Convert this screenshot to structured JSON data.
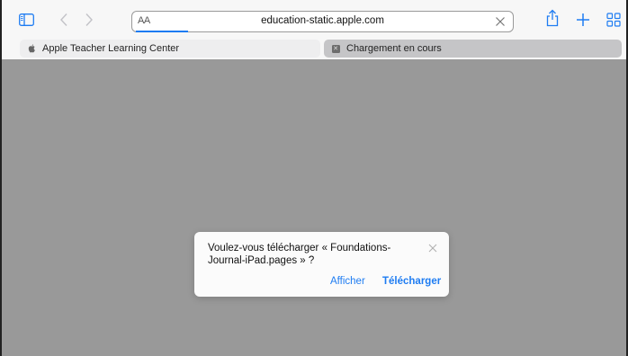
{
  "toolbar": {
    "reader_label": "AA",
    "url": "education-static.apple.com",
    "accent": "#1e7cf2"
  },
  "tabs": [
    {
      "title": "Apple Teacher Learning Center",
      "icon": "apple-logo-icon",
      "active": false
    },
    {
      "title": "Chargement en cours",
      "icon": "page-placeholder-icon",
      "active": true
    }
  ],
  "dialog": {
    "message": "Voulez-vous télécharger « Foundations-Journal-iPad.pages » ?",
    "show_label": "Afficher",
    "download_label": "Télécharger"
  },
  "content": {
    "background": "#999999"
  }
}
